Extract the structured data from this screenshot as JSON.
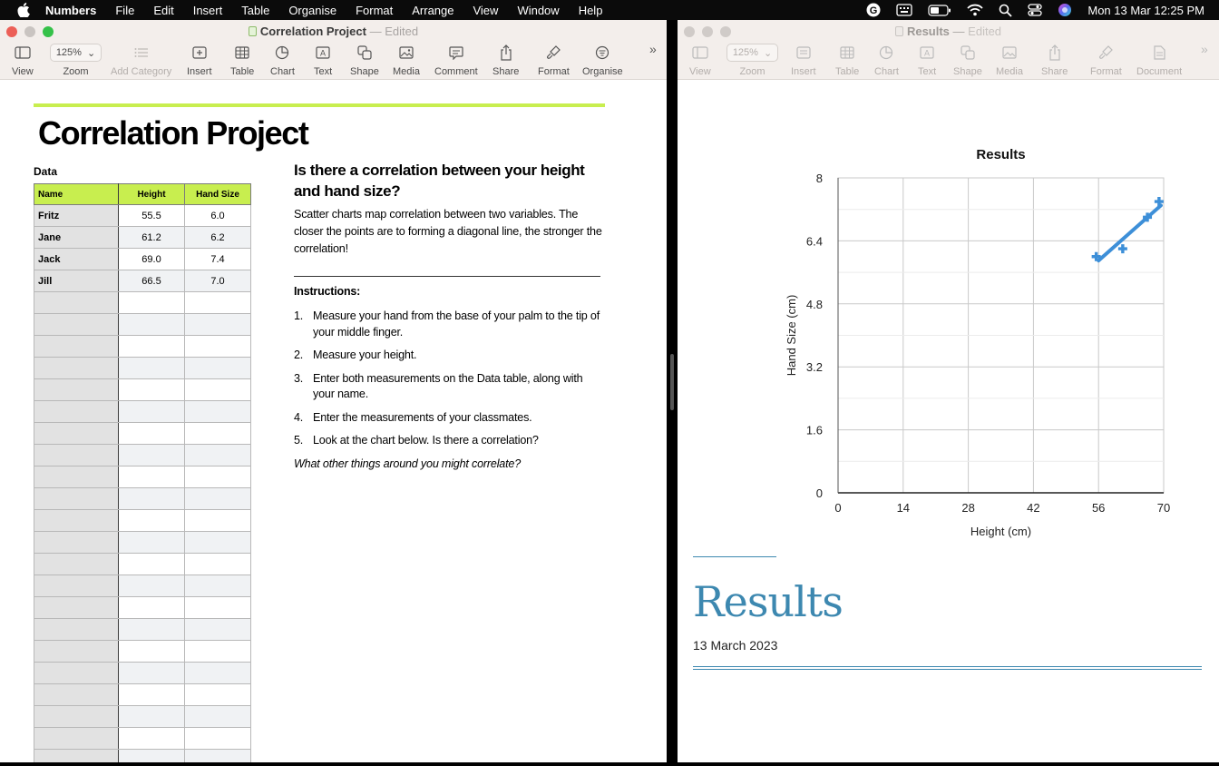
{
  "menubar": {
    "app": "Numbers",
    "items": [
      "File",
      "Edit",
      "Insert",
      "Table",
      "Organise",
      "Format",
      "Arrange",
      "View",
      "Window",
      "Help"
    ],
    "clock": "Mon 13 Mar  12:25 PM"
  },
  "left_window": {
    "title": "Correlation Project",
    "separator": "—",
    "status": "Edited",
    "toolbar": {
      "view": "View",
      "zoom_value": "125%",
      "zoom": "Zoom",
      "add_category": "Add Category",
      "insert": "Insert",
      "table": "Table",
      "chart": "Chart",
      "text": "Text",
      "shape": "Shape",
      "media": "Media",
      "comment": "Comment",
      "share": "Share",
      "format": "Format",
      "organise": "Organise"
    },
    "doc": {
      "title": "Correlation Project",
      "data_label": "Data",
      "table": {
        "headers": [
          "Name",
          "Height",
          "Hand Size"
        ],
        "rows": [
          [
            "Fritz",
            "55.5",
            "6.0"
          ],
          [
            "Jane",
            "61.2",
            "6.2"
          ],
          [
            "Jack",
            "69.0",
            "7.4"
          ],
          [
            "Jill",
            "66.5",
            "7.0"
          ]
        ]
      },
      "question": "Is there a correlation between your height and hand size?",
      "intro": "Scatter charts map correlation between two variables. The closer the points are to forming a diagonal line, the stronger the correlation!",
      "instructions_heading": "Instructions:",
      "steps": [
        {
          "n": "1.",
          "text": "Measure your hand from the base of your palm to the tip of your middle finger."
        },
        {
          "n": "2.",
          "text": "Measure your height."
        },
        {
          "n": "3.",
          "text": "Enter both measurements on the Data table, along with your name."
        },
        {
          "n": "4.",
          "text": "Enter the measurements of your classmates."
        },
        {
          "n": "5.",
          "text": "Look at the chart below. Is there a correlation?"
        }
      ],
      "closing_question": "What other things around you might correlate?"
    }
  },
  "right_window": {
    "title": "Results",
    "separator": "—",
    "status": "Edited",
    "toolbar": {
      "view": "View",
      "zoom_value": "125%",
      "zoom": "Zoom",
      "insert": "Insert",
      "table": "Table",
      "chart": "Chart",
      "text": "Text",
      "shape": "Shape",
      "media": "Media",
      "share": "Share",
      "format": "Format",
      "document": "Document"
    },
    "doc": {
      "heading": "Results",
      "date": "13 March 2023"
    }
  },
  "chart_data": {
    "type": "scatter",
    "title": "Results",
    "xlabel": "Height (cm)",
    "ylabel": "Hand Size (cm)",
    "xlim": [
      0,
      70
    ],
    "ylim": [
      0,
      8
    ],
    "xticks": [
      0,
      14,
      28,
      42,
      56,
      70
    ],
    "yticks": [
      0,
      1.6,
      3.2,
      4.8,
      6.4,
      8
    ],
    "grid": true,
    "series": [
      {
        "x": [
          55.5,
          61.2,
          69.0,
          66.5
        ],
        "y": [
          6.0,
          6.2,
          7.4,
          7.0
        ],
        "color": "#3d8fd8",
        "marker": "plus"
      }
    ],
    "trendline": {
      "x": [
        56,
        69.4
      ],
      "y": [
        5.9,
        7.3
      ],
      "color": "#3d8fd8"
    }
  },
  "colors": {
    "accent_green": "#c8ee4f",
    "results_blue": "#3d88b0",
    "series_blue": "#3d8fd8"
  }
}
